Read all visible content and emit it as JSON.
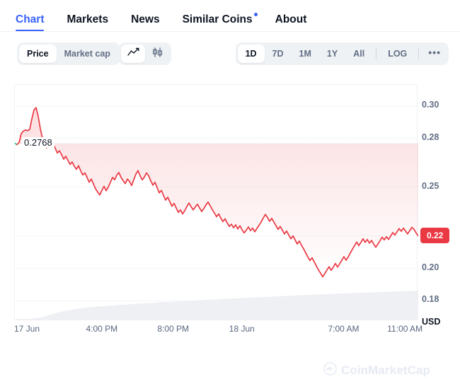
{
  "tabs": [
    {
      "label": "Chart",
      "active": true,
      "badge": false
    },
    {
      "label": "Markets",
      "active": false,
      "badge": false
    },
    {
      "label": "News",
      "active": false,
      "badge": false
    },
    {
      "label": "Similar Coins",
      "active": false,
      "badge": true
    },
    {
      "label": "About",
      "active": false,
      "badge": false
    }
  ],
  "toolbar": {
    "metric_options": [
      {
        "label": "Price",
        "active": true
      },
      {
        "label": "Market cap",
        "active": false
      }
    ],
    "chart_type_options": [
      {
        "icon": "line-chart-icon",
        "active": true
      },
      {
        "icon": "candlestick-chart-icon",
        "active": false
      }
    ],
    "ranges": [
      {
        "label": "1D",
        "active": true
      },
      {
        "label": "7D",
        "active": false
      },
      {
        "label": "1M",
        "active": false
      },
      {
        "label": "1Y",
        "active": false
      },
      {
        "label": "All",
        "active": false
      }
    ],
    "log_label": "LOG",
    "more_label": "•••"
  },
  "chart_data": {
    "type": "line",
    "title": "",
    "xlabel": "",
    "ylabel": "USD",
    "currency": "USD",
    "ylim": [
      0.168,
      0.313
    ],
    "grid": true,
    "legend_position": "none",
    "y_ticks": [
      "0.30",
      "0.28",
      "0.25",
      "0.22",
      "0.20",
      "0.18"
    ],
    "y_tick_values": [
      0.3,
      0.28,
      0.25,
      0.22,
      0.2,
      0.18
    ],
    "x_ticks": [
      "17 Jun",
      "4:00 PM",
      "8:00 PM",
      "18 Jun",
      "7:00 AM",
      "11:00 AM"
    ],
    "open_price_label": "0.2768",
    "open_price": 0.2768,
    "current_price_label": "0.22",
    "current_price": 0.22,
    "colors": {
      "up": "#16c784",
      "down": "#ea3943",
      "accent": "#3861fb",
      "grid": "#f2f4f7",
      "volume": "#eef0f4",
      "text_muted": "#616e85"
    },
    "series": [
      {
        "name": "Price",
        "values": [
          0.277,
          0.2762,
          0.2775,
          0.283,
          0.2845,
          0.2852,
          0.2848,
          0.2856,
          0.292,
          0.2975,
          0.299,
          0.2935,
          0.286,
          0.28,
          0.2755,
          0.2742,
          0.276,
          0.2785,
          0.2768,
          0.274,
          0.271,
          0.2724,
          0.27,
          0.2672,
          0.269,
          0.2665,
          0.264,
          0.2655,
          0.2628,
          0.261,
          0.2632,
          0.26,
          0.2575,
          0.2588,
          0.256,
          0.253,
          0.255,
          0.252,
          0.249,
          0.247,
          0.2452,
          0.248,
          0.2505,
          0.2478,
          0.25,
          0.253,
          0.256,
          0.2545,
          0.2575,
          0.259,
          0.256,
          0.254,
          0.2522,
          0.255,
          0.2535,
          0.251,
          0.2545,
          0.258,
          0.2602,
          0.257,
          0.2545,
          0.2562,
          0.2588,
          0.257,
          0.254,
          0.2512,
          0.253,
          0.2498,
          0.2465,
          0.248,
          0.245,
          0.242,
          0.2438,
          0.241,
          0.2382,
          0.24,
          0.2372,
          0.2345,
          0.236,
          0.2335,
          0.2355,
          0.238,
          0.2402,
          0.238,
          0.236,
          0.2378,
          0.2395,
          0.2372,
          0.235,
          0.2368,
          0.239,
          0.2408,
          0.2385,
          0.2362,
          0.234,
          0.2318,
          0.2335,
          0.231,
          0.2288,
          0.2305,
          0.228,
          0.2258,
          0.2272,
          0.225,
          0.2268,
          0.2242,
          0.2262,
          0.2238,
          0.2218,
          0.2235,
          0.2255,
          0.2232,
          0.2248,
          0.2225,
          0.2245,
          0.2265,
          0.2285,
          0.231,
          0.2332,
          0.2312,
          0.229,
          0.2308,
          0.2285,
          0.2262,
          0.224,
          0.2258,
          0.2235,
          0.2212,
          0.223,
          0.2205,
          0.2182,
          0.22,
          0.2175,
          0.215,
          0.2168,
          0.2142,
          0.212,
          0.2095,
          0.207,
          0.2048,
          0.2065,
          0.204,
          0.2015,
          0.199,
          0.197,
          0.1948,
          0.1968,
          0.199,
          0.201,
          0.1988,
          0.2008,
          0.203,
          0.2008,
          0.2028,
          0.205,
          0.2072,
          0.205,
          0.207,
          0.2095,
          0.2118,
          0.214,
          0.2162,
          0.214,
          0.216,
          0.2182,
          0.216,
          0.2178,
          0.2155,
          0.2172,
          0.215,
          0.213,
          0.215,
          0.217,
          0.2192,
          0.2175,
          0.2195,
          0.2178,
          0.2198,
          0.222,
          0.2205,
          0.2225,
          0.2245,
          0.2228,
          0.2248,
          0.223,
          0.2212,
          0.2232,
          0.2252,
          0.224,
          0.2218,
          0.22
        ]
      },
      {
        "name": "Volume",
        "values": [
          0.02,
          0.02,
          0.03,
          0.04,
          0.05,
          0.07,
          0.09,
          0.12,
          0.16,
          0.2,
          0.24,
          0.28,
          0.31,
          0.34,
          0.36,
          0.38,
          0.4,
          0.42,
          0.44,
          0.45,
          0.46,
          0.47,
          0.48,
          0.49,
          0.5,
          0.51,
          0.52,
          0.53,
          0.54,
          0.55,
          0.56,
          0.57,
          0.57,
          0.58,
          0.59,
          0.6,
          0.61,
          0.62,
          0.62,
          0.63,
          0.64,
          0.65,
          0.65,
          0.66,
          0.67,
          0.68,
          0.68,
          0.69,
          0.7,
          0.7,
          0.71,
          0.72,
          0.72,
          0.73,
          0.74,
          0.74,
          0.75,
          0.76,
          0.76,
          0.77,
          0.78,
          0.78,
          0.79,
          0.8,
          0.8,
          0.81,
          0.82,
          0.82,
          0.83,
          0.84,
          0.84,
          0.85,
          0.85,
          0.86,
          0.87,
          0.87,
          0.88,
          0.88,
          0.89,
          0.9,
          0.9,
          0.91,
          0.91,
          0.92,
          0.92,
          0.93,
          0.93,
          0.94,
          0.94,
          0.95,
          0.95,
          0.96,
          0.96,
          0.97,
          0.97,
          0.98,
          0.98,
          0.99,
          0.99,
          1.0
        ]
      }
    ]
  },
  "watermark": {
    "text": "CoinMarketCap",
    "icon": "coinmarketcap-logo-icon"
  }
}
